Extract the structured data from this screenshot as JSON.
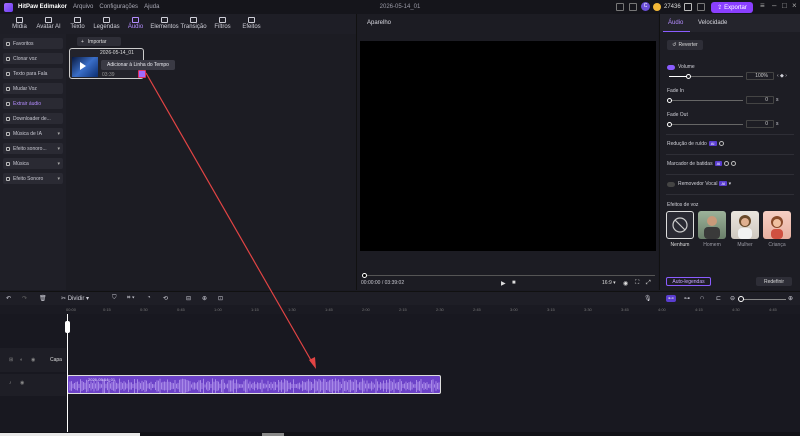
{
  "app": {
    "title": "HitPaw Edimakor",
    "menus": [
      "Arquivo",
      "Configurações",
      "Ajuda"
    ],
    "project_title": "2026-05-14_01",
    "avatar_letter": "C",
    "coins": "27436",
    "export_label": "Exportar",
    "accent": "#8a3fff"
  },
  "toolbar": {
    "tools": [
      {
        "label": "Mídia",
        "icon": "media-icon"
      },
      {
        "label": "Avatar AI",
        "icon": "avatar-ai-icon"
      },
      {
        "label": "Texto",
        "icon": "text-icon"
      },
      {
        "label": "Legendas",
        "icon": "subtitles-icon"
      },
      {
        "label": "Áudio",
        "icon": "audio-icon"
      },
      {
        "label": "Elementos",
        "icon": "elements-icon"
      },
      {
        "label": "Transição",
        "icon": "transition-icon"
      },
      {
        "label": "Filtros",
        "icon": "filters-icon"
      },
      {
        "label": "Efeitos",
        "icon": "effects-icon"
      }
    ],
    "active": "Áudio"
  },
  "sidebar": {
    "items": [
      {
        "label": "Favoritos",
        "icon": "star-icon"
      },
      {
        "label": "Clonar voz",
        "icon": "clone-voice-icon"
      },
      {
        "label": "Texto para Fala",
        "icon": "text-to-speech-icon"
      },
      {
        "label": "Mudar Voz",
        "icon": "change-voice-icon"
      },
      {
        "label": "Extrair áudio",
        "icon": "extract-audio-icon",
        "active": true
      },
      {
        "label": "Downloader de...",
        "icon": "download-icon"
      },
      {
        "label": "Música de IA",
        "icon": "ai-music-icon",
        "dropdown": true
      },
      {
        "label": "Efeito sonoro...",
        "icon": "sound-effect-icon",
        "dropdown": true
      },
      {
        "label": "Música",
        "icon": "music-icon",
        "dropdown": true
      },
      {
        "label": "Efeito Sonoro",
        "icon": "sound-fx-icon",
        "dropdown": true
      }
    ]
  },
  "media": {
    "import_label": "Importar",
    "clip_title": "2026-05-14_01",
    "clip_duration": "03:39",
    "tooltip": "Adicionar à Linha do Tempo"
  },
  "player": {
    "title": "Aparelho",
    "time": "00:00:00 / 03:39:02",
    "ratio": "16:9"
  },
  "properties": {
    "tabs": [
      "Áudio",
      "Velocidade"
    ],
    "active_tab": "Áudio",
    "revert_label": "Reverter",
    "volume": {
      "label": "Volume",
      "value": "100%",
      "level": 0.25
    },
    "fade_in": {
      "label": "Fade In",
      "value": "0",
      "unit": "s"
    },
    "fade_out": {
      "label": "Fade Out",
      "value": "0",
      "unit": "s"
    },
    "noise_reduction": "Redução de ruído",
    "beat_marker": "Marcador de batidas",
    "vocal_remover": "Removedor Vocal",
    "ai_badge": "AI",
    "voice_effects_label": "Efeitos de voz",
    "voices": [
      "Nenhum",
      "Homem",
      "Mulher",
      "Criança"
    ],
    "auto_subtitles": "Auto-legendas",
    "redefine": "Redefinir"
  },
  "timeline": {
    "split_label": "Dividir",
    "ruler": [
      "00:00",
      "0:15",
      "0:30",
      "0:45",
      "1:00",
      "1:15",
      "1:30",
      "1:45",
      "2:00",
      "2:15",
      "2:30",
      "2:45",
      "3:00",
      "3:15",
      "3:30",
      "3:45",
      "4:00",
      "4:15",
      "4:30",
      "4:45",
      "5:00"
    ],
    "capa_label": "Capa",
    "audio_clip_title": "2026-05-14_01"
  }
}
